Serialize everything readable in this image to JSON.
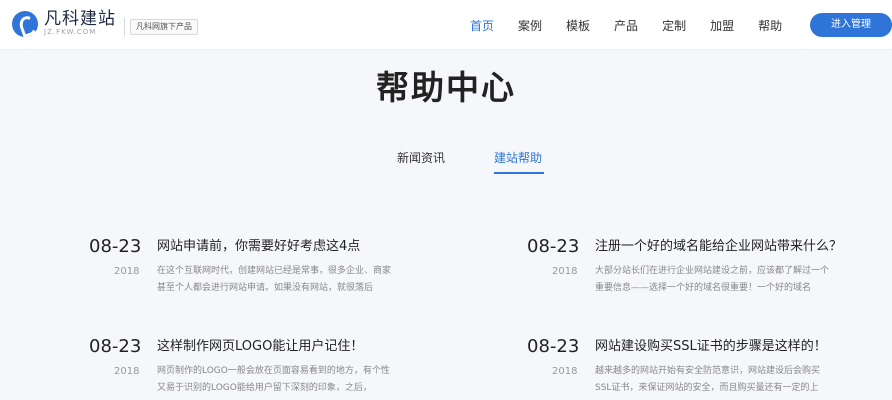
{
  "header": {
    "logo_title": "凡科建站",
    "logo_sub": "JZ.FKW.COM",
    "logo_tag": "凡科网旗下产品",
    "nav": [
      "首页",
      "案例",
      "模板",
      "产品",
      "定制",
      "加盟",
      "帮助"
    ],
    "active_index": 0,
    "admin_button": "进入管理"
  },
  "page": {
    "title": "帮助中心",
    "tabs": [
      "新闻资讯",
      "建站帮助"
    ],
    "active_tab": 1
  },
  "articles": [
    {
      "day": "08-23",
      "year": "2018",
      "title": "网站申请前，你需要好好考虑这4点",
      "desc": "在这个互联网时代，创建网站已经是常事，很多企业、商家甚至个人都会进行网站申请。如果没有网站，就很落后"
    },
    {
      "day": "08-23",
      "year": "2018",
      "title": "注册一个好的域名能给企业网站带来什么？",
      "desc": "大部分站长们在进行企业网站建设之前，应该都了解过一个重要信息——选择一个好的域名很重要！一个好的域名"
    },
    {
      "day": "08-23",
      "year": "2018",
      "title": "这样制作网页LOGO能让用户记住！",
      "desc": "网页制作的LOGO一般会放在页面容易看到的地方，有个性又易于识别的LOGO能给用户留下深刻的印象，之后，"
    },
    {
      "day": "08-23",
      "year": "2018",
      "title": "网站建设购买SSL证书的步骤是这样的！",
      "desc": "越来越多的网站开始有安全防范意识，网站建设后会购买SSL证书，来保证网站的安全，而且购买量还有一定的上"
    }
  ]
}
